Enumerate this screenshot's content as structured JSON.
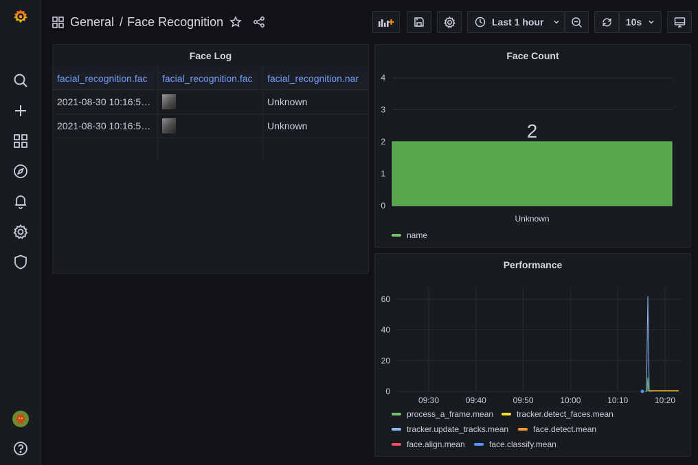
{
  "sidebar": {
    "logo": "grafana-logo-icon",
    "items": [
      "search-icon",
      "plus-icon",
      "dashboards-icon",
      "explore-icon",
      "alerting-icon",
      "configuration-icon",
      "server-admin-icon"
    ],
    "bottom": [
      "user-avatar",
      "help-icon"
    ]
  },
  "header": {
    "folder": "General",
    "separator": "/",
    "title": "Face Recognition",
    "time_range": "Last 1 hour",
    "refresh_interval": "10s"
  },
  "face_log": {
    "title": "Face Log",
    "columns": [
      "facial_recognition.fac",
      "facial_recognition.fac",
      "facial_recognition.nar"
    ],
    "rows": [
      {
        "time": "2021-08-30 10:16:5…",
        "name": "Unknown"
      },
      {
        "time": "2021-08-30 10:16:5…",
        "name": "Unknown"
      }
    ]
  },
  "face_count": {
    "title": "Face Count",
    "chart_data": {
      "type": "bar",
      "categories": [
        "Unknown"
      ],
      "series": [
        {
          "name": "name",
          "values": [
            2
          ],
          "color": "#56a64b"
        }
      ],
      "value_label": "2",
      "ylim": [
        0,
        4
      ],
      "yticks": [
        "0",
        "1",
        "2",
        "3",
        "4"
      ],
      "grid": true,
      "legend": "bottom-left"
    }
  },
  "performance": {
    "title": "Performance",
    "chart_data": {
      "type": "line",
      "xticks": [
        "09:30",
        "09:40",
        "09:50",
        "10:00",
        "10:10",
        "10:20"
      ],
      "yticks": [
        "0",
        "20",
        "40",
        "60"
      ],
      "ylim": [
        0,
        68
      ],
      "grid": true,
      "legend": "bottom-left",
      "series": [
        {
          "name": "process_a_frame.mean",
          "color": "#73bf69"
        },
        {
          "name": "tracker.detect_faces.mean",
          "color": "#fade2a"
        },
        {
          "name": "tracker.update_tracks.mean",
          "color": "#8ab8ff"
        },
        {
          "name": "face.detect.mean",
          "color": "#ff9830"
        },
        {
          "name": "face.align.mean",
          "color": "#f2495c"
        },
        {
          "name": "face.classify.mean",
          "color": "#5794f2"
        }
      ]
    }
  }
}
